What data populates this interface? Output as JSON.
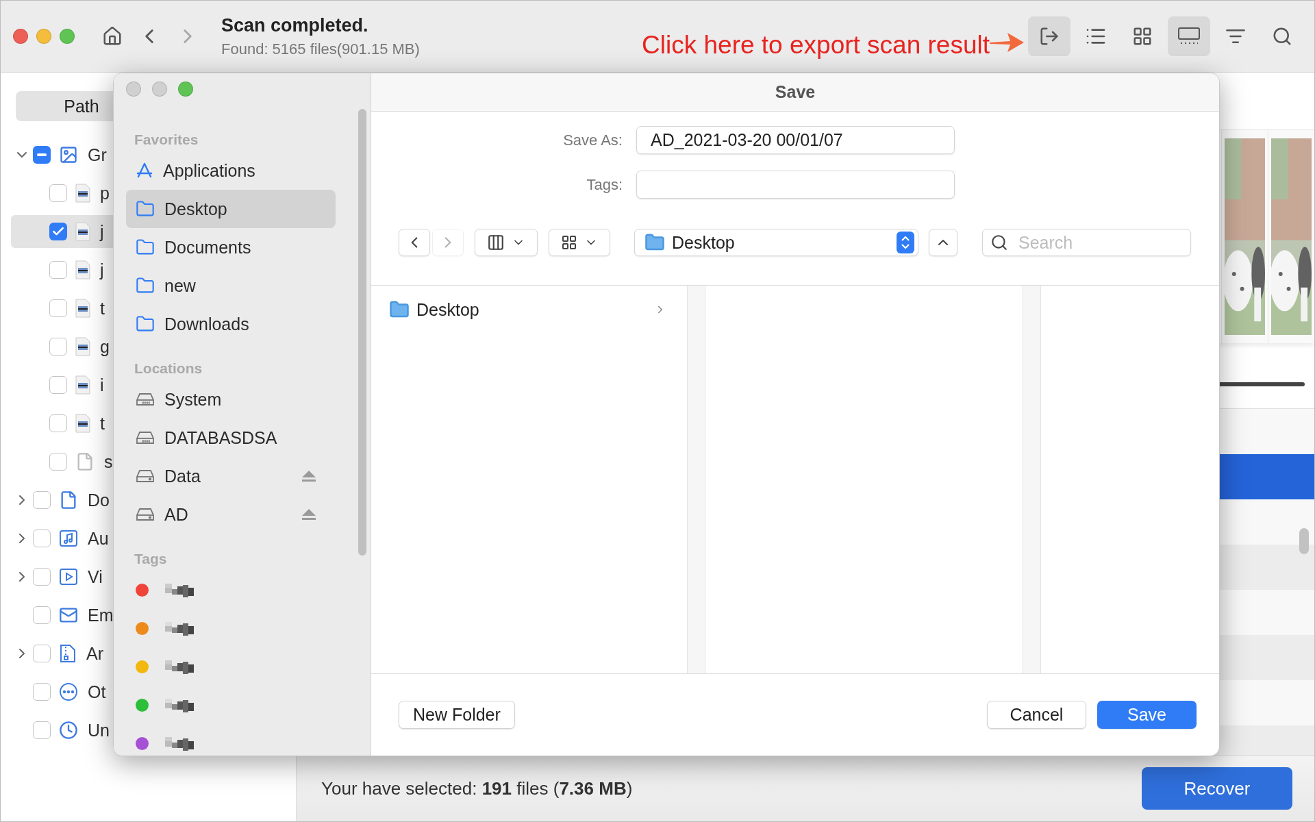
{
  "toolbar": {
    "nav": [
      {
        "kind": "home",
        "disabled": false
      },
      {
        "kind": "back",
        "disabled": false
      },
      {
        "kind": "forward",
        "disabled": true
      }
    ],
    "title": "Scan completed.",
    "subtitle": "Found: 5165 files(901.15 MB)",
    "annotation": "Click here to export scan result",
    "views": [
      {
        "kind": "export",
        "highlighted": true
      },
      {
        "kind": "list",
        "highlighted": false
      },
      {
        "kind": "grid",
        "highlighted": false
      },
      {
        "kind": "filmstrip",
        "highlighted": true
      },
      {
        "kind": "filter",
        "highlighted": false
      },
      {
        "kind": "search",
        "highlighted": false
      }
    ]
  },
  "sidebar": {
    "tab": "Path",
    "tree": [
      {
        "label": "Gr",
        "kind": "images",
        "expandable": true,
        "expanded": true,
        "checked": false,
        "partial": true,
        "selected": false,
        "children": [
          {
            "label": "p",
            "kind": "image-file",
            "checked": false,
            "selected": false
          },
          {
            "label": "j",
            "kind": "image-file",
            "checked": true,
            "selected": true
          },
          {
            "label": "j",
            "kind": "image-file",
            "checked": false,
            "selected": false
          },
          {
            "label": "t",
            "kind": "image-file",
            "checked": false,
            "selected": false
          },
          {
            "label": "g",
            "kind": "image-file",
            "checked": false,
            "selected": false
          },
          {
            "label": "i",
            "kind": "image-file",
            "checked": false,
            "selected": false
          },
          {
            "label": "t",
            "kind": "image-file",
            "checked": false,
            "selected": false
          },
          {
            "label": "s",
            "kind": "blank-file",
            "checked": false,
            "selected": false
          }
        ]
      },
      {
        "label": "Do",
        "kind": "document",
        "expandable": true,
        "expanded": false,
        "checked": false,
        "selected": false
      },
      {
        "label": "Au",
        "kind": "audio",
        "expandable": true,
        "expanded": false,
        "checked": false,
        "selected": false
      },
      {
        "label": "Vi",
        "kind": "video",
        "expandable": true,
        "expanded": false,
        "checked": false,
        "selected": false
      },
      {
        "label": "Em",
        "kind": "email",
        "expandable": false,
        "checked": false,
        "selected": false
      },
      {
        "label": "Ar",
        "kind": "archive",
        "expandable": true,
        "expanded": false,
        "checked": false,
        "selected": false
      },
      {
        "label": "Ot",
        "kind": "other",
        "expandable": false,
        "checked": false,
        "selected": false
      },
      {
        "label": "Un",
        "kind": "recent",
        "expandable": false,
        "checked": false,
        "selected": false
      }
    ]
  },
  "dialog": {
    "title": "Save",
    "sections": [
      {
        "heading": "Favorites",
        "items": [
          {
            "label": "Applications",
            "kind": "apps",
            "selected": false,
            "ejectable": false
          },
          {
            "label": "Desktop",
            "kind": "folder",
            "selected": true,
            "ejectable": false
          },
          {
            "label": "Documents",
            "kind": "folder",
            "selected": false,
            "ejectable": false
          },
          {
            "label": "new",
            "kind": "folder",
            "selected": false,
            "ejectable": false
          },
          {
            "label": "Downloads",
            "kind": "folder",
            "selected": false,
            "ejectable": false
          }
        ]
      },
      {
        "heading": "Locations",
        "items": [
          {
            "label": "System",
            "kind": "disk",
            "selected": false,
            "ejectable": false
          },
          {
            "label": "DATABASDSA",
            "kind": "disk",
            "selected": false,
            "ejectable": false
          },
          {
            "label": "Data",
            "kind": "volume",
            "selected": false,
            "ejectable": true
          },
          {
            "label": "AD",
            "kind": "volume",
            "selected": false,
            "ejectable": true
          }
        ]
      }
    ],
    "tags": {
      "heading": "Tags",
      "items": [
        {
          "color": "#f0443a"
        },
        {
          "color": "#ec8a1c"
        },
        {
          "color": "#f2b80e"
        },
        {
          "color": "#2dbe3a"
        },
        {
          "color": "#a650d6"
        }
      ]
    },
    "save_as": {
      "label": "Save As:",
      "value": "AD_2021-03-20 00/01/07"
    },
    "tags_field": {
      "label": "Tags:"
    },
    "nav": [
      {
        "kind": "back",
        "disabled": false
      },
      {
        "kind": "forward",
        "disabled": true
      }
    ],
    "location": "Desktop",
    "search": {
      "placeholder": "Search"
    },
    "column": [
      {
        "label": "Desktop",
        "has_children": true
      }
    ],
    "buttons": [
      {
        "label": "New Folder",
        "kind": "plain"
      },
      {
        "label": "Cancel",
        "kind": "plain"
      },
      {
        "label": "Save",
        "kind": "default"
      }
    ]
  },
  "status": {
    "text": "Your have selected: **191** files (**7.36 MB**)",
    "button": "Recover"
  }
}
